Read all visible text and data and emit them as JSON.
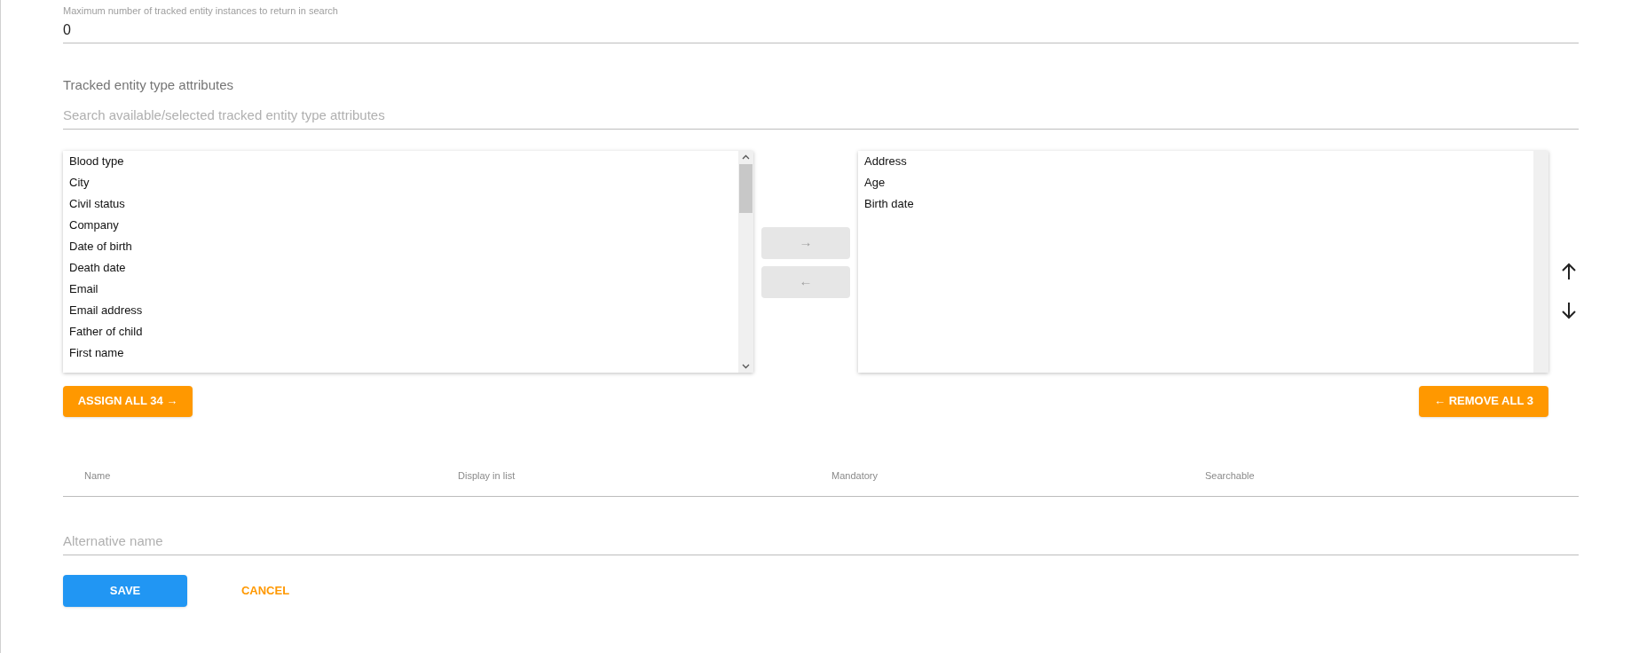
{
  "max_field": {
    "label": "Maximum number of tracked entity instances to return in search",
    "value": "0"
  },
  "section_title": "Tracked entity type attributes",
  "search": {
    "placeholder": "Search available/selected tracked entity type attributes"
  },
  "available": [
    "Blood type",
    "City",
    "Civil status",
    "Company",
    "Date of birth",
    "Death date",
    "Email",
    "Email address",
    "Father of child",
    "First name"
  ],
  "selected": [
    "Address",
    "Age",
    "Birth date"
  ],
  "move_buttons": [
    {
      "label": "→",
      "disabled": true
    },
    {
      "label": "←",
      "disabled": true
    }
  ],
  "assign_all": "ASSIGN ALL 34 →",
  "remove_all": "← REMOVE ALL 3",
  "table": {
    "columns": [
      "Name",
      "Display in list",
      "Mandatory",
      "Searchable"
    ]
  },
  "alt_name": {
    "placeholder": "Alternative name"
  },
  "buttons": [
    {
      "label": "SAVE",
      "kind": "primary"
    },
    {
      "label": "CANCEL",
      "kind": "flat"
    }
  ]
}
